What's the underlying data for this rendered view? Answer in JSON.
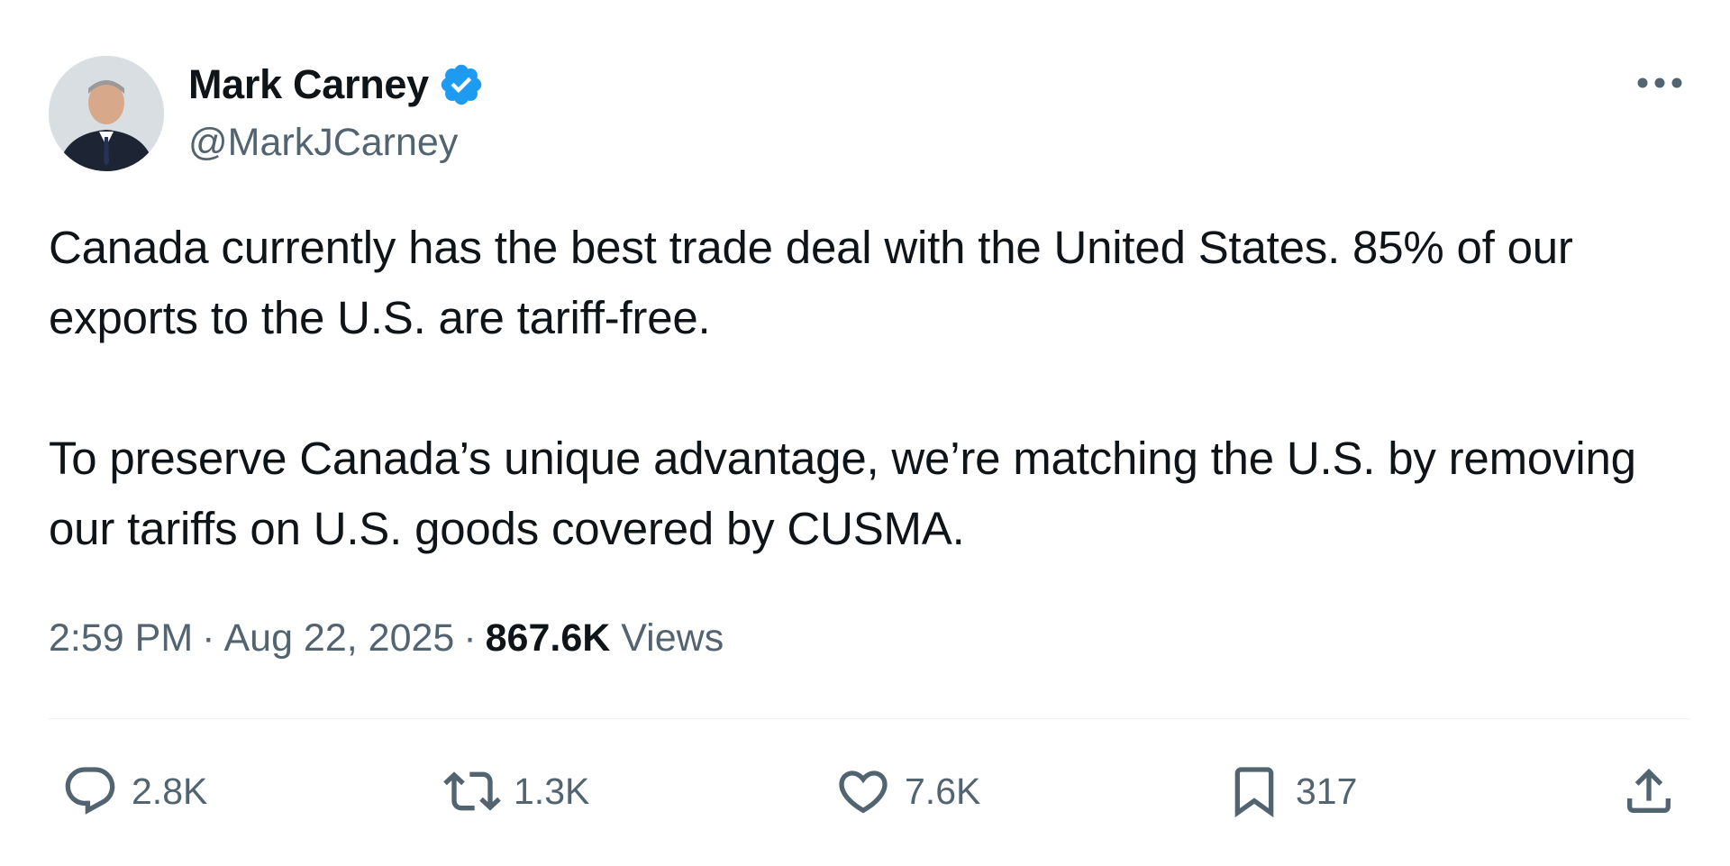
{
  "author": {
    "display_name": "Mark Carney",
    "handle": "@MarkJCarney",
    "verified": true,
    "verified_color": "#1d9bf0"
  },
  "tweet": {
    "paragraphs": [
      "Canada currently has the best trade deal with the United States. 85% of our exports to the U.S. are tariff-free.",
      "To preserve Canada’s unique advantage, we’re matching the U.S. by removing our tariffs on U.S. goods covered by CUSMA."
    ]
  },
  "meta": {
    "time": "2:59 PM",
    "separator": "·",
    "date": "Aug 22, 2025",
    "views_count": "867.6K",
    "views_label": "Views"
  },
  "actions": {
    "replies": "2.8K",
    "reposts": "1.3K",
    "likes": "7.6K",
    "bookmarks": "317"
  },
  "icons": {
    "more": "more-horizontal-icon",
    "reply": "reply-bubble-icon",
    "repost": "repost-icon",
    "like": "heart-icon",
    "bookmark": "bookmark-icon",
    "share": "share-upload-icon",
    "verified": "verified-badge-icon"
  },
  "colors": {
    "text_primary": "#0f1419",
    "text_secondary": "#536471",
    "divider": "#eff3f4"
  }
}
